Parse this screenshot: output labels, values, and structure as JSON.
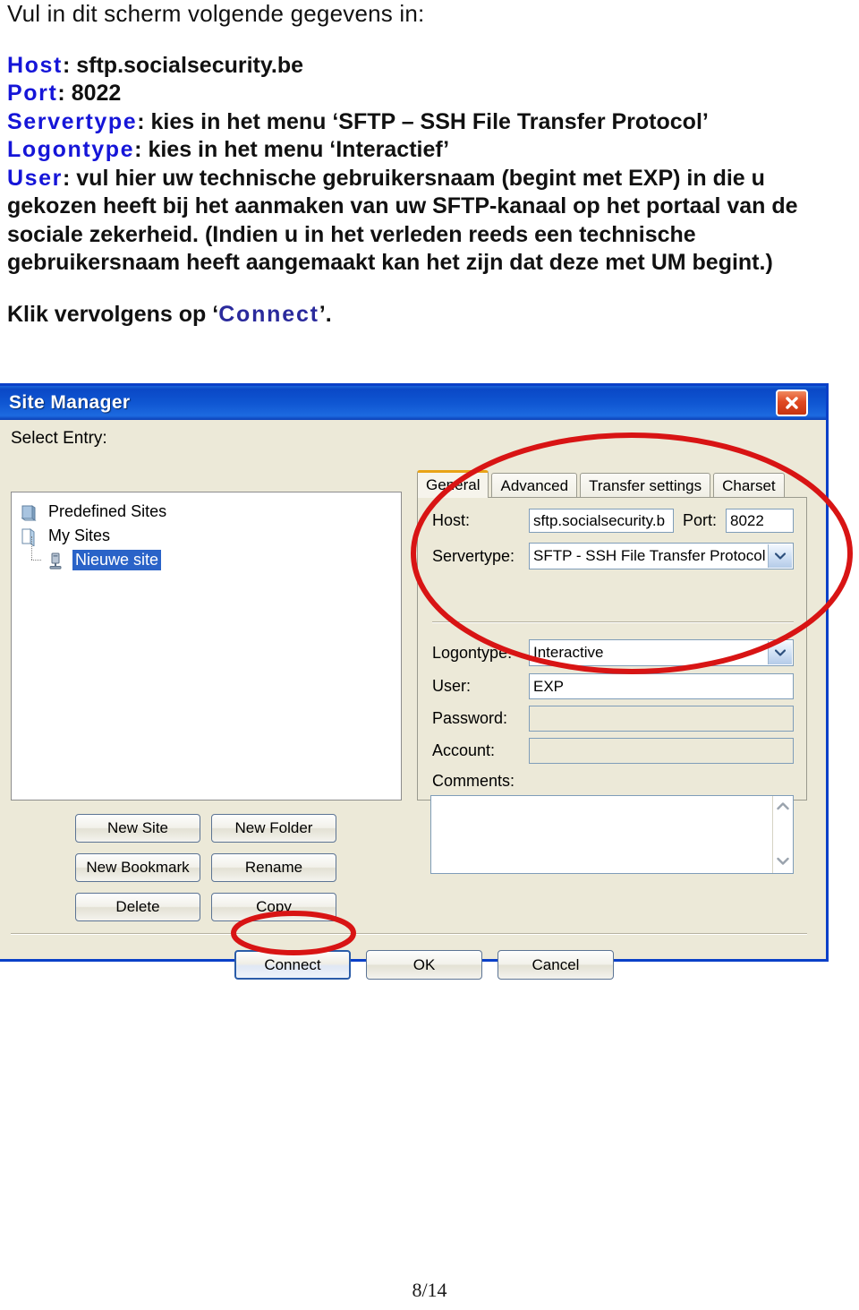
{
  "document": {
    "intro": "Vul in dit scherm volgende gegevens in:",
    "fields": [
      {
        "label": "Host",
        "sep": ": ",
        "value": "sftp.socialsecurity.be"
      },
      {
        "label": "Port",
        "sep": ": ",
        "value": "8022"
      },
      {
        "label": "Servertype",
        "sep": ": ",
        "value": "kies in het menu ‘SFTP – SSH File Transfer Protocol’"
      },
      {
        "label": "Logontype",
        "sep": ": ",
        "value": "kies in het menu ‘Interactief’"
      }
    ],
    "user_label": "User",
    "user_sep": ": ",
    "user_text_a": "vul hier uw technische gebruikersnaam (begint met ",
    "user_bold_a": "EXP",
    "user_text_b": ") in die u gekozen heeft bij het aanmaken van uw SFTP-kanaal op het portaal van de sociale zekerheid. (Indien u in het verleden reeds een technische gebruikersnaam heeft aangemaakt kan het zijn dat deze met ",
    "user_bold_b": "UM",
    "user_text_c": " begint.)",
    "closing_prefix": "Klik vervolgens op ‘",
    "closing_highlight": "Connect",
    "closing_suffix": "’.",
    "page_number": "8/14"
  },
  "dialog": {
    "title": "Site Manager",
    "close_icon": "close-icon",
    "select_entry_label": "Select Entry:",
    "tree": [
      {
        "label": "Predefined Sites",
        "icon": "folder-icon",
        "selected": false,
        "child": false
      },
      {
        "label": "My Sites",
        "icon": "folder-open-icon",
        "selected": false,
        "child": false
      },
      {
        "label": "Nieuwe site",
        "icon": "server-icon",
        "selected": true,
        "child": true
      }
    ],
    "left_buttons": [
      "New Site",
      "New Folder",
      "New Bookmark",
      "Rename",
      "Delete",
      "Copy"
    ],
    "tabs": [
      {
        "label": "General",
        "active": true
      },
      {
        "label": "Advanced",
        "active": false
      },
      {
        "label": "Transfer settings",
        "active": false
      },
      {
        "label": "Charset",
        "active": false
      }
    ],
    "form": {
      "host_label": "Host:",
      "host_value": "sftp.socialsecurity.b",
      "port_label": "Port:",
      "port_value": "8022",
      "servertype_label": "Servertype:",
      "servertype_value": "SFTP - SSH File Transfer Protocol",
      "logontype_label": "Logontype:",
      "logontype_value": "Interactive",
      "user_label": "User:",
      "user_value": "EXP",
      "password_label": "Password:",
      "password_value": "",
      "account_label": "Account:",
      "account_value": "",
      "comments_label": "Comments:",
      "comments_value": ""
    },
    "bottom_buttons": [
      "Connect",
      "OK",
      "Cancel"
    ]
  },
  "colors": {
    "label_blue": "#1515d8",
    "connect_blue": "#2a2a9c",
    "titlebar_blue": "#0f56d2",
    "selection_blue": "#2a63c8",
    "annotation_red": "#d81414",
    "active_tab_gold": "#e8a317",
    "dialog_face": "#ece9d8"
  }
}
